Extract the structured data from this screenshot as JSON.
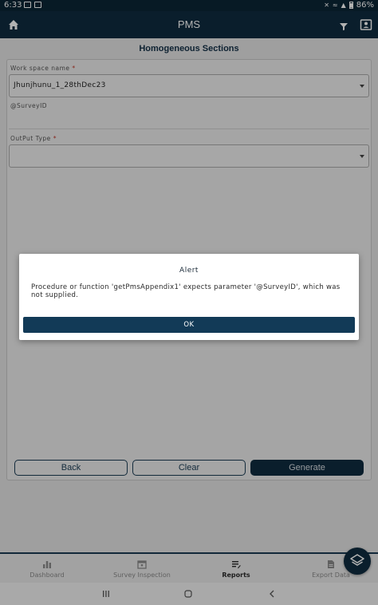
{
  "status_bar": {
    "time": "6:33",
    "battery": "86%"
  },
  "app_bar": {
    "title": "PMS"
  },
  "page": {
    "title": "Homogeneous Sections"
  },
  "form": {
    "workspace": {
      "label": "Work space name",
      "required_mark": "*",
      "value": "Jhunjhunu_1_28thDec23"
    },
    "survey_id_text": "@SurveyID",
    "output_type": {
      "label": "OutPut Type",
      "required_mark": "*",
      "value": ""
    }
  },
  "buttons": {
    "back": "Back",
    "clear": "Clear",
    "generate": "Generate"
  },
  "bottom_nav": {
    "items": [
      {
        "label": "Dashboard",
        "icon": "bar-chart-icon"
      },
      {
        "label": "Survey Inspection",
        "icon": "calendar-icon"
      },
      {
        "label": "Reports",
        "icon": "report-icon",
        "active": true
      },
      {
        "label": "Export Data",
        "icon": "document-icon"
      }
    ]
  },
  "fab": {
    "icon": "layers-icon"
  },
  "dialog": {
    "title": "Alert",
    "message": "Procedure or function 'getPmsAppendix1' expects parameter '@SurveyID', which was not supplied.",
    "ok": "OK"
  },
  "colors": {
    "primary": "#0f2c3f",
    "accent_button": "#123a57",
    "required": "#c0392b"
  }
}
